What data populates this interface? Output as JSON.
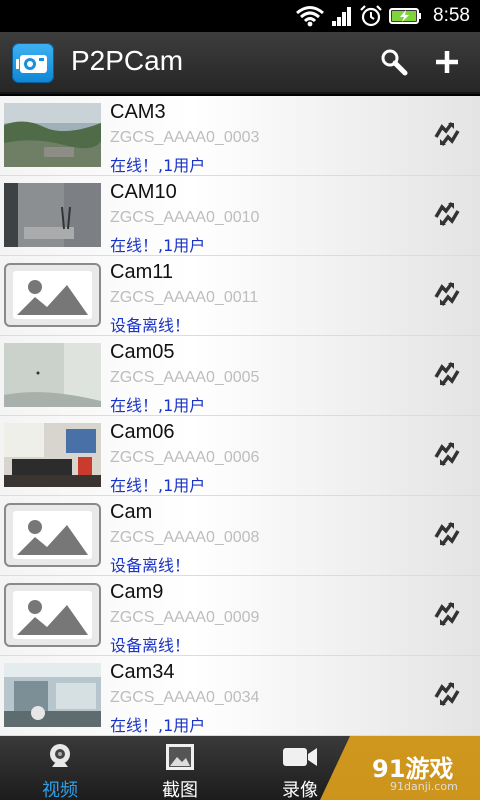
{
  "status_bar": {
    "time": "8:58"
  },
  "app": {
    "title": "P2PCam",
    "search_icon": "search-icon",
    "add_icon": "plus-icon"
  },
  "cameras": [
    {
      "name": "CAM3",
      "id": "ZGCS_AAAA0_0003",
      "status": "在线！,1用户",
      "thumb": "photo-outdoor"
    },
    {
      "name": "CAM10",
      "id": "ZGCS_AAAA0_0010",
      "status": "在线！,1用户",
      "thumb": "photo-room"
    },
    {
      "name": "Cam11",
      "id": "ZGCS_AAAA0_0011",
      "status": "设备离线！",
      "thumb": "placeholder"
    },
    {
      "name": "Cam05",
      "id": "ZGCS_AAAA0_0005",
      "status": "在线！,1用户",
      "thumb": "photo-wall"
    },
    {
      "name": "Cam06",
      "id": "ZGCS_AAAA0_0006",
      "status": "在线！,1用户",
      "thumb": "photo-desk"
    },
    {
      "name": "Cam",
      "id": "ZGCS_AAAA0_0008",
      "status": "设备离线！",
      "thumb": "placeholder"
    },
    {
      "name": "Cam9",
      "id": "ZGCS_AAAA0_0009",
      "status": "设备离线！",
      "thumb": "placeholder"
    },
    {
      "name": "Cam34",
      "id": "ZGCS_AAAA0_0034",
      "status": "在线！,1用户",
      "thumb": "photo-office"
    }
  ],
  "tabs": [
    {
      "label": "视频",
      "icon": "webcam-icon",
      "active": true
    },
    {
      "label": "截图",
      "icon": "picture-icon",
      "active": false
    },
    {
      "label": "录像",
      "icon": "video-camera-icon",
      "active": false
    }
  ],
  "watermark": {
    "text": "91游戏",
    "sub": "91danji.com"
  },
  "colors": {
    "accent": "#2f9fe8",
    "status_text": "#1a33c8",
    "id_text": "#bdbdbd"
  }
}
